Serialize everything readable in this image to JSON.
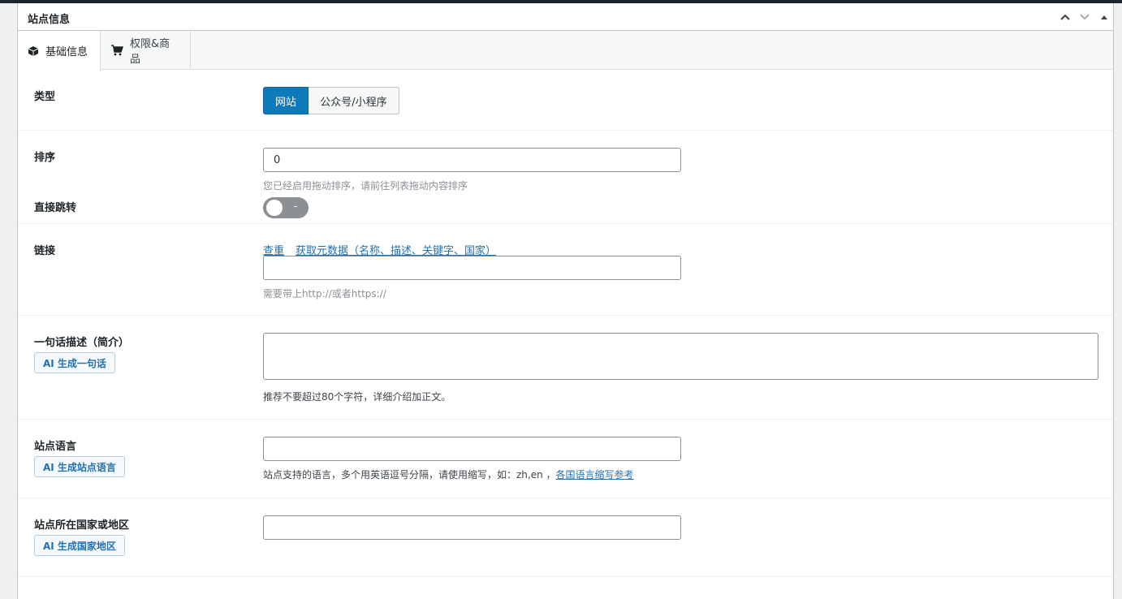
{
  "panel": {
    "title": "站点信息"
  },
  "tabs": [
    {
      "label": "基础信息",
      "icon": "cube-icon",
      "active": true
    },
    {
      "label": "权限&商品",
      "icon": "cart-icon",
      "active": false
    }
  ],
  "type_row": {
    "label": "类型",
    "options": [
      "网站",
      "公众号/小程序"
    ],
    "selected": "网站"
  },
  "order_row": {
    "label": "排序",
    "value": "0",
    "hint": "您已经启用拖动排序，请前往列表拖动内容排序"
  },
  "redirect_row": {
    "label": "直接跳转",
    "toggle_text": "-",
    "on": false
  },
  "link_row": {
    "label": "链接",
    "check_link": "查重",
    "fetch_link": "获取元数据（名称、描述、关键字、国家）",
    "value": "",
    "hint": "需要带上http://或者https://"
  },
  "summary_row": {
    "label": "一句话描述（简介）",
    "ai_button": "AI 生成一句话",
    "value": "",
    "hint": "推荐不要超过80个字符，详细介绍加正文。"
  },
  "language_row": {
    "label": "站点语言",
    "ai_button": "AI 生成站点语言",
    "value": "",
    "hint": "站点支持的语言，多个用英语逗号分隔，请使用缩写，如：zh,en ，",
    "hint_link": "各国语言缩写参考"
  },
  "country_row": {
    "label": "站点所在国家或地区",
    "ai_button": "AI 生成国家地区",
    "value": ""
  },
  "colors": {
    "accent": "#0e7ab9",
    "link": "#2271b1",
    "topbar": "#1d2327"
  }
}
